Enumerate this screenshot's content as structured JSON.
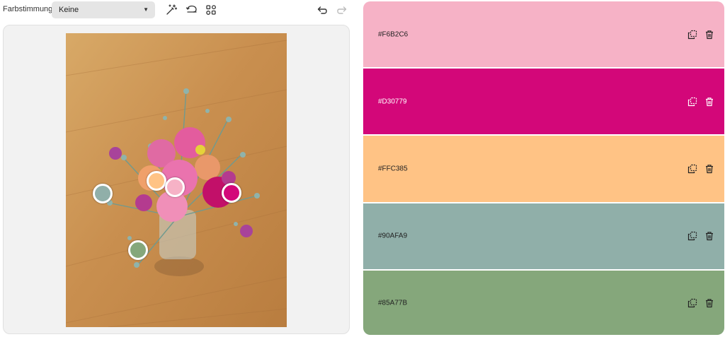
{
  "toolbar": {
    "mood_label": "Farbstimmung",
    "mood_value": "Keine"
  },
  "pickers": [
    {
      "color": "#90AFA9"
    },
    {
      "color": "#FFC385"
    },
    {
      "color": "#F6B2C6"
    },
    {
      "color": "#D30779"
    },
    {
      "color": "#85A77B"
    }
  ],
  "palette": [
    {
      "hex": "#F6B2C6",
      "color": "#F6B2C6",
      "text_color": "#222222"
    },
    {
      "hex": "#D30779",
      "color": "#D30779",
      "text_color": "#ffffff"
    },
    {
      "hex": "#FFC385",
      "color": "#FFC385",
      "text_color": "#222222"
    },
    {
      "hex": "#90AFA9",
      "color": "#90AFA9",
      "text_color": "#222222"
    },
    {
      "hex": "#85A77B",
      "color": "#85A77B",
      "text_color": "#222222"
    }
  ]
}
